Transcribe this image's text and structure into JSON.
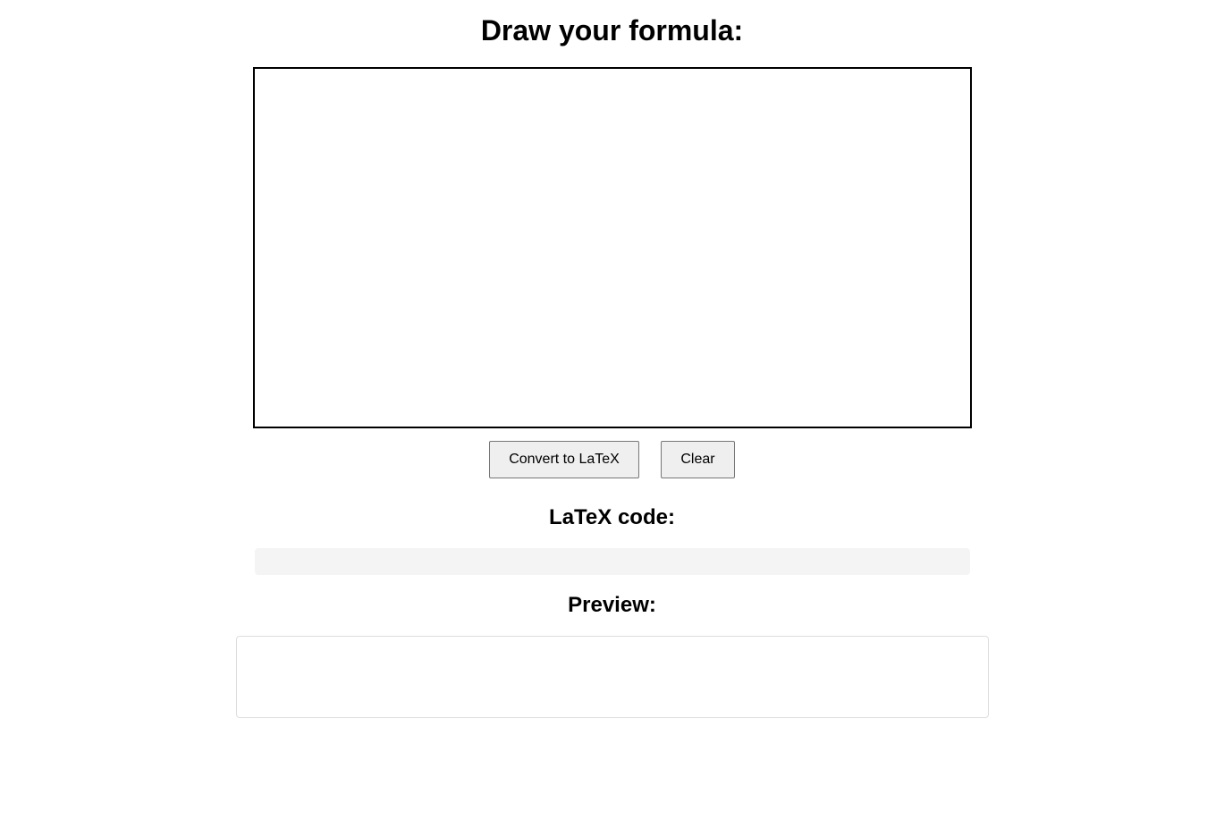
{
  "header": {
    "title": "Draw your formula:"
  },
  "drawing_area": {
    "stroke_color": "#000000",
    "background_color": "#ffffff"
  },
  "actions": {
    "convert_label": "Convert to LaTeX",
    "clear_label": "Clear"
  },
  "latex": {
    "heading": "LaTeX code:",
    "code": ""
  },
  "preview": {
    "heading": "Preview:",
    "content": ""
  }
}
